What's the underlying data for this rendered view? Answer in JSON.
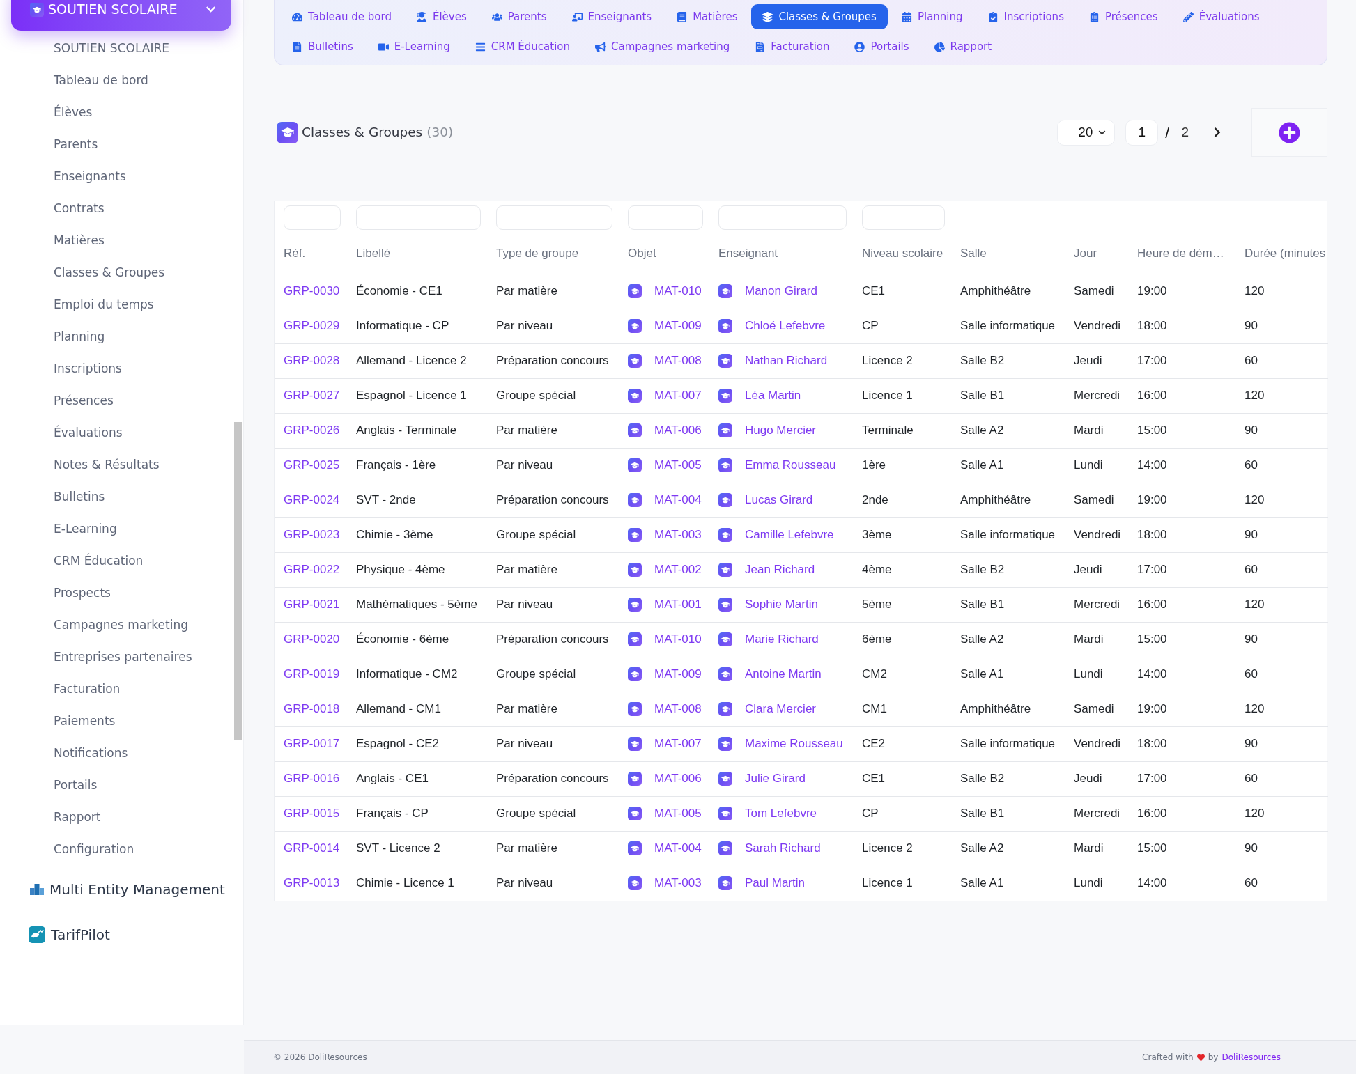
{
  "sidebar": {
    "module_button": {
      "label": "SOUTIEN SCOLAIRE",
      "expanded": true
    },
    "items": [
      {
        "label": "SOUTIEN SCOLAIRE"
      },
      {
        "label": "Tableau de bord"
      },
      {
        "label": "Élèves"
      },
      {
        "label": "Parents"
      },
      {
        "label": "Enseignants"
      },
      {
        "label": "Contrats"
      },
      {
        "label": "Matières"
      },
      {
        "label": "Classes & Groupes"
      },
      {
        "label": "Emploi du temps"
      },
      {
        "label": "Planning"
      },
      {
        "label": "Inscriptions"
      },
      {
        "label": "Présences"
      },
      {
        "label": "Évaluations"
      },
      {
        "label": "Notes & Résultats"
      },
      {
        "label": "Bulletins"
      },
      {
        "label": "E-Learning"
      },
      {
        "label": "CRM Éducation"
      },
      {
        "label": "Prospects"
      },
      {
        "label": "Campagnes marketing"
      },
      {
        "label": "Entreprises partenaires"
      },
      {
        "label": "Facturation"
      },
      {
        "label": "Paiements"
      },
      {
        "label": "Notifications"
      },
      {
        "label": "Portails"
      },
      {
        "label": "Rapport"
      },
      {
        "label": "Configuration"
      }
    ],
    "modules": [
      {
        "kind": "blocks",
        "label": "Multi Entity Management"
      },
      {
        "kind": "tile",
        "label": "TarifPilot"
      }
    ]
  },
  "nav": {
    "tabs": [
      {
        "label": "Tableau de bord",
        "selected": false
      },
      {
        "label": "Élèves",
        "selected": false
      },
      {
        "label": "Parents",
        "selected": false
      },
      {
        "label": "Enseignants",
        "selected": false
      },
      {
        "label": "Matières",
        "selected": false
      },
      {
        "label": "Classes & Groupes",
        "selected": true
      },
      {
        "label": "Planning",
        "selected": false
      },
      {
        "label": "Inscriptions",
        "selected": false
      },
      {
        "label": "Présences",
        "selected": false
      },
      {
        "label": "Évaluations",
        "selected": false
      },
      {
        "label": "Bulletins",
        "selected": false
      },
      {
        "label": "E-Learning",
        "selected": false
      },
      {
        "label": "CRM Éducation",
        "selected": false
      },
      {
        "label": "Campagnes marketing",
        "selected": false
      },
      {
        "label": "Facturation",
        "selected": false
      },
      {
        "label": "Portails",
        "selected": false
      },
      {
        "label": "Rapport",
        "selected": false
      }
    ]
  },
  "page_header": {
    "title": "Classes & Groupes",
    "count": "(30)",
    "page_size": "20",
    "page": "1",
    "separator": "/",
    "total_pages": "2"
  },
  "table": {
    "columns": [
      {
        "label": "Réf.",
        "kind": "link",
        "filter": true
      },
      {
        "label": "Libellé",
        "kind": "text",
        "filter": true
      },
      {
        "label": "Type de groupe",
        "kind": "text",
        "filter": true
      },
      {
        "label": "Objet",
        "kind": "icon_link",
        "filter": true
      },
      {
        "label": "Enseignant",
        "kind": "icon_link",
        "filter": true
      },
      {
        "label": "Niveau scolaire",
        "kind": "text",
        "filter": true
      },
      {
        "label": "Salle",
        "kind": "text",
        "filter": false
      },
      {
        "label": "Jour",
        "kind": "text",
        "filter": false
      },
      {
        "label": "Heure de dém…",
        "kind": "text",
        "filter": false
      },
      {
        "label": "Durée (minutes",
        "kind": "text",
        "filter": false
      }
    ],
    "rows": [
      [
        "GRP-0030",
        "Économie - CE1",
        "Par matière",
        "MAT-010",
        "Manon Girard",
        "CE1",
        "Amphithéâtre",
        "Samedi",
        "19:00",
        "120"
      ],
      [
        "GRP-0029",
        "Informatique - CP",
        "Par niveau",
        "MAT-009",
        "Chloé Lefebvre",
        "CP",
        "Salle informatique",
        "Vendredi",
        "18:00",
        "90"
      ],
      [
        "GRP-0028",
        "Allemand - Licence 2",
        "Préparation concours",
        "MAT-008",
        "Nathan Richard",
        "Licence 2",
        "Salle B2",
        "Jeudi",
        "17:00",
        "60"
      ],
      [
        "GRP-0027",
        "Espagnol - Licence 1",
        "Groupe spécial",
        "MAT-007",
        "Léa Martin",
        "Licence 1",
        "Salle B1",
        "Mercredi",
        "16:00",
        "120"
      ],
      [
        "GRP-0026",
        "Anglais - Terminale",
        "Par matière",
        "MAT-006",
        "Hugo Mercier",
        "Terminale",
        "Salle A2",
        "Mardi",
        "15:00",
        "90"
      ],
      [
        "GRP-0025",
        "Français - 1ère",
        "Par niveau",
        "MAT-005",
        "Emma Rousseau",
        "1ère",
        "Salle A1",
        "Lundi",
        "14:00",
        "60"
      ],
      [
        "GRP-0024",
        "SVT - 2nde",
        "Préparation concours",
        "MAT-004",
        "Lucas Girard",
        "2nde",
        "Amphithéâtre",
        "Samedi",
        "19:00",
        "120"
      ],
      [
        "GRP-0023",
        "Chimie - 3ème",
        "Groupe spécial",
        "MAT-003",
        "Camille Lefebvre",
        "3ème",
        "Salle informatique",
        "Vendredi",
        "18:00",
        "90"
      ],
      [
        "GRP-0022",
        "Physique - 4ème",
        "Par matière",
        "MAT-002",
        "Jean Richard",
        "4ème",
        "Salle B2",
        "Jeudi",
        "17:00",
        "60"
      ],
      [
        "GRP-0021",
        "Mathématiques - 5ème",
        "Par niveau",
        "MAT-001",
        "Sophie Martin",
        "5ème",
        "Salle B1",
        "Mercredi",
        "16:00",
        "120"
      ],
      [
        "GRP-0020",
        "Économie - 6ème",
        "Préparation concours",
        "MAT-010",
        "Marie Richard",
        "6ème",
        "Salle A2",
        "Mardi",
        "15:00",
        "90"
      ],
      [
        "GRP-0019",
        "Informatique - CM2",
        "Groupe spécial",
        "MAT-009",
        "Antoine Martin",
        "CM2",
        "Salle A1",
        "Lundi",
        "14:00",
        "60"
      ],
      [
        "GRP-0018",
        "Allemand - CM1",
        "Par matière",
        "MAT-008",
        "Clara Mercier",
        "CM1",
        "Amphithéâtre",
        "Samedi",
        "19:00",
        "120"
      ],
      [
        "GRP-0017",
        "Espagnol - CE2",
        "Par niveau",
        "MAT-007",
        "Maxime Rousseau",
        "CE2",
        "Salle informatique",
        "Vendredi",
        "18:00",
        "90"
      ],
      [
        "GRP-0016",
        "Anglais - CE1",
        "Préparation concours",
        "MAT-006",
        "Julie Girard",
        "CE1",
        "Salle B2",
        "Jeudi",
        "17:00",
        "60"
      ],
      [
        "GRP-0015",
        "Français - CP",
        "Groupe spécial",
        "MAT-005",
        "Tom Lefebvre",
        "CP",
        "Salle B1",
        "Mercredi",
        "16:00",
        "120"
      ],
      [
        "GRP-0014",
        "SVT - Licence 2",
        "Par matière",
        "MAT-004",
        "Sarah Richard",
        "Licence 2",
        "Salle A2",
        "Mardi",
        "15:00",
        "90"
      ],
      [
        "GRP-0013",
        "Chimie - Licence 1",
        "Par niveau",
        "MAT-003",
        "Paul Martin",
        "Licence 1",
        "Salle A1",
        "Lundi",
        "14:00",
        "60"
      ]
    ]
  },
  "footer": {
    "copyright": "© 2026 DoliResources",
    "credit_prefix": "Crafted with",
    "credit_by": "by",
    "credit_link": "DoliResources"
  }
}
